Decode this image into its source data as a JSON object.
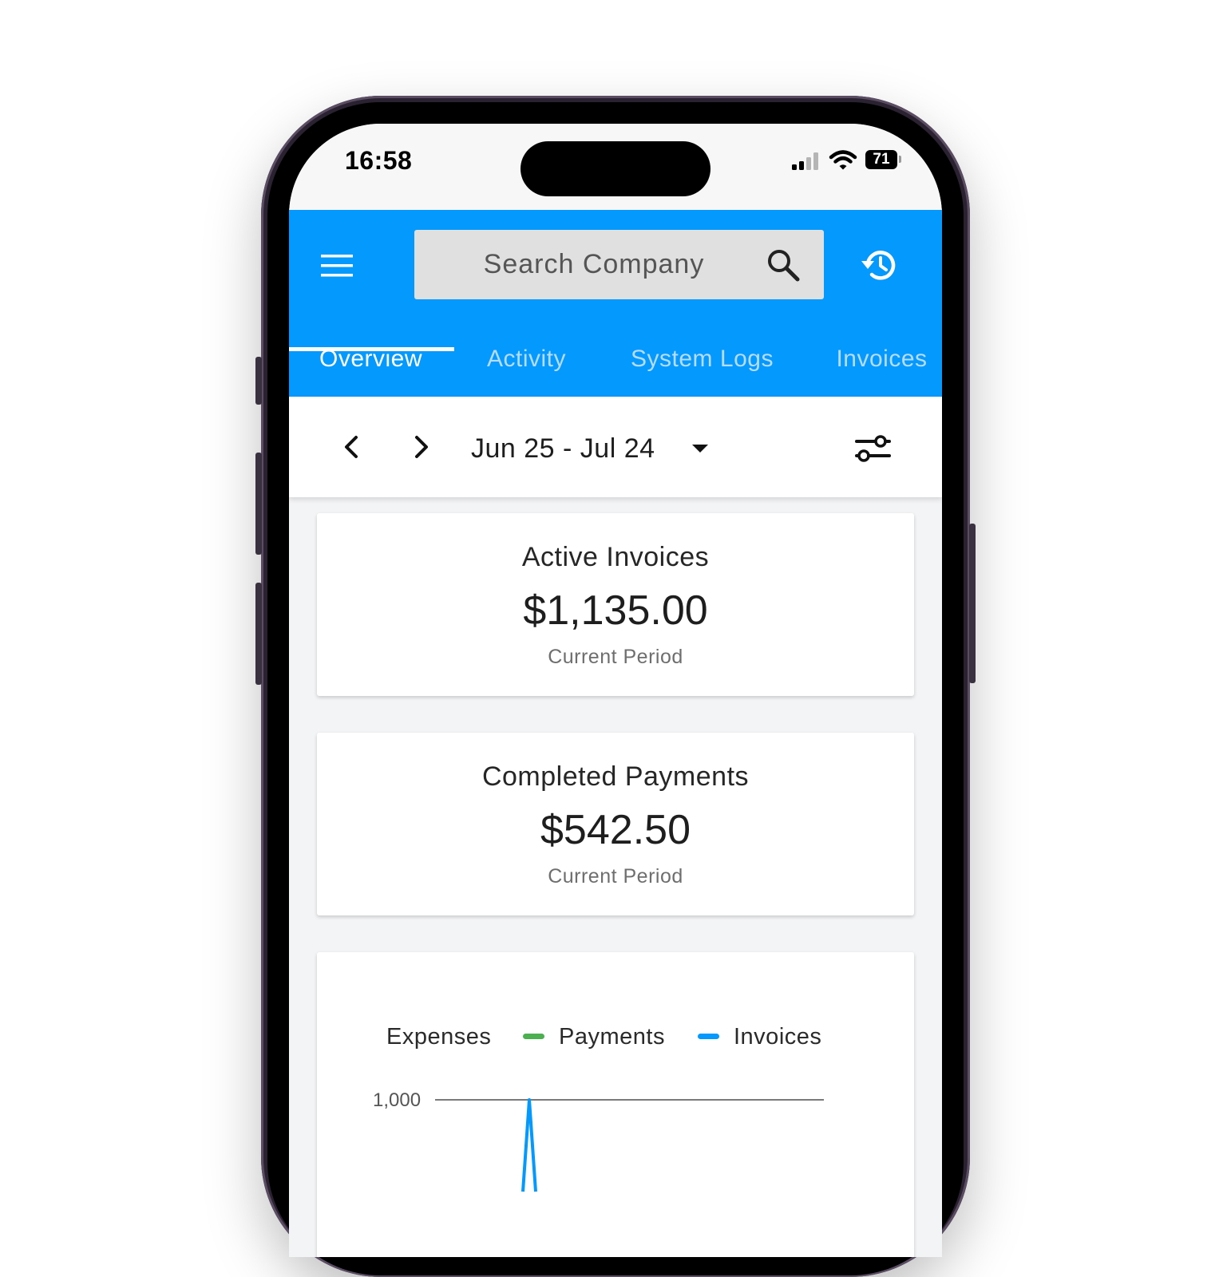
{
  "status_bar": {
    "time": "16:58",
    "battery_level": "71"
  },
  "header": {
    "search_placeholder": "Search Company",
    "menu_icon": "hamburger-menu-icon",
    "search_icon": "magnifier-icon",
    "history_icon": "history-clock-icon",
    "accent_color": "#0499fc"
  },
  "tabs": [
    {
      "label": "Overview",
      "active": true
    },
    {
      "label": "Activity",
      "active": false
    },
    {
      "label": "System Logs",
      "active": false
    },
    {
      "label": "Invoices",
      "active": false
    }
  ],
  "date_bar": {
    "range": "Jun 25 - Jul 24",
    "prev_icon": "chevron-left-icon",
    "next_icon": "chevron-right-icon",
    "filter_icon": "sliders-icon"
  },
  "cards": [
    {
      "title": "Active Invoices",
      "value": "$1,135.00",
      "subtitle": "Current Period"
    },
    {
      "title": "Completed Payments",
      "value": "$542.50",
      "subtitle": "Current Period"
    }
  ],
  "chart_data": {
    "type": "line",
    "legend_position": "top",
    "legend": [
      {
        "name": "Expenses",
        "color": null
      },
      {
        "name": "Payments",
        "color": "#4caf50"
      },
      {
        "name": "Invoices",
        "color": "#0499fc"
      }
    ],
    "y_ticks": [
      "1,000"
    ],
    "series": [
      {
        "name": "Invoices",
        "color": "#0499fc",
        "visible_peak": 1000
      }
    ]
  }
}
